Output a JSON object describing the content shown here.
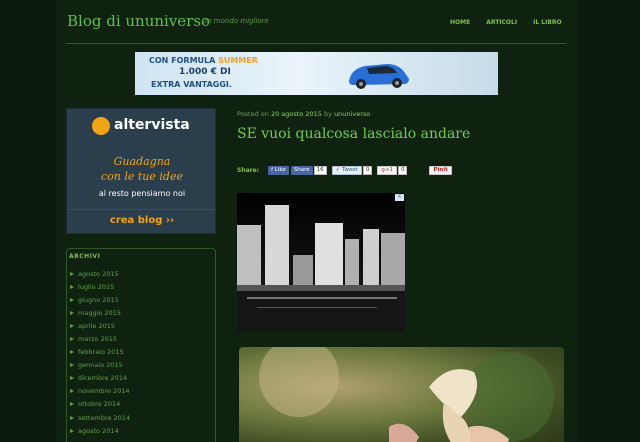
{
  "header": {
    "site_title": "Blog di ununiverso",
    "tagline": "Un mondo migliore",
    "nav": [
      "HOME",
      "ARTICOLI",
      "IL LIBRO"
    ]
  },
  "banner_ad": {
    "line1_prefix": "CON FORMULA",
    "line1_highlight": "SUMMER",
    "line2": "1.000 € DI",
    "line3": "EXTRA VANTAGGI."
  },
  "sidebar_ad": {
    "brand": "altervista",
    "line1": "Guadagna",
    "line2": "con le tue idee",
    "line3": "al resto pensiamo noi",
    "cta": "crea blog ››"
  },
  "archive": {
    "title": "ARCHIVI",
    "months": [
      "agosto 2015",
      "luglio 2015",
      "giugno 2015",
      "maggio 2015",
      "aprile 2015",
      "marzo 2015",
      "febbraio 2015",
      "gennaio 2015",
      "dicembre 2014",
      "novembre 2014",
      "ottobre 2014",
      "settembre 2014",
      "agosto 2014"
    ]
  },
  "post": {
    "meta_prefix": "Posted on",
    "date": "20 agosto 2015",
    "meta_by": "by",
    "author": "ununiverso",
    "title": "SE vuoi qualcosa lascialo andare",
    "share_label": "Share:",
    "share": {
      "fb_like": "Like",
      "fb_share": "Share",
      "fb_count": "16",
      "tweet": "Tweet",
      "tweet_count": "0",
      "gplus": "g+1",
      "gplus_count": "0",
      "pin": "Pinit"
    },
    "ad_choice": "X"
  },
  "colors": {
    "background": "#0c1a0c",
    "title_green": "#5fc04a",
    "accent_orange": "#f2a413"
  }
}
